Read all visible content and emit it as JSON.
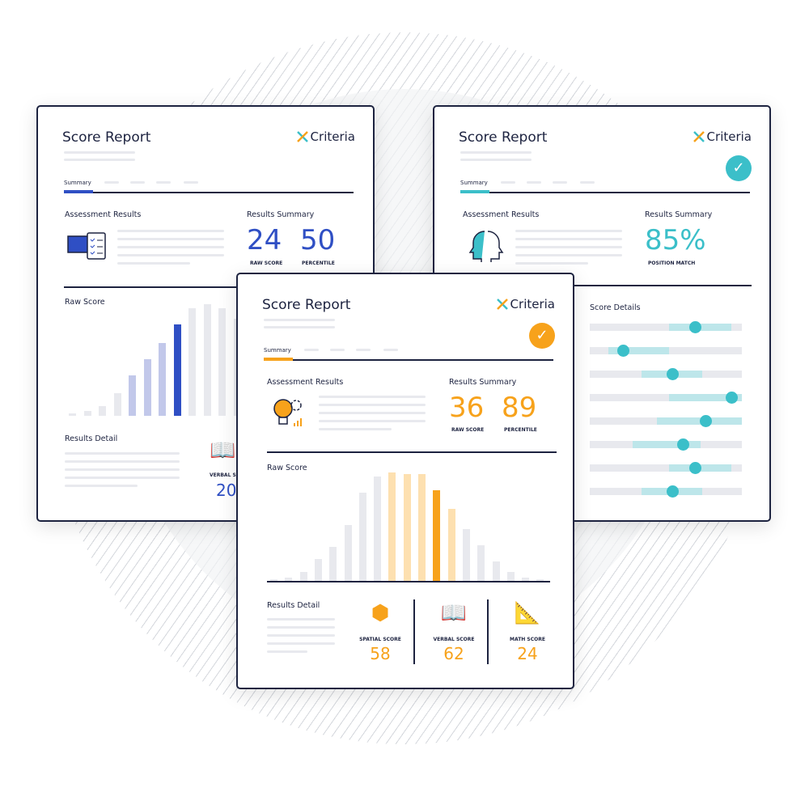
{
  "colors": {
    "navy": "#1d2340",
    "blue": "#2f4fc4",
    "teal": "#3bbfc9",
    "orange": "#f7a21b"
  },
  "brand": "Criteria",
  "left_card": {
    "title": "Score Report",
    "tab": "Summary",
    "assessment_heading": "Assessment Results",
    "summary_heading": "Results Summary",
    "raw_score": "24",
    "raw_score_label": "RAW SCORE",
    "percentile": "50",
    "percentile_label": "PERCENTILE",
    "chart_heading": "Raw Score",
    "detail_heading": "Results Detail",
    "verbal_label": "VERBAL SCORE",
    "verbal_value": "20",
    "icon": "computer-checklist-icon",
    "bars": [
      3,
      6,
      12,
      28,
      50,
      70,
      90,
      113,
      133,
      138,
      133,
      120
    ],
    "highlight_index": 7
  },
  "right_card": {
    "title": "Score Report",
    "tab": "Summary",
    "assessment_heading": "Assessment Results",
    "summary_heading": "Results Summary",
    "match": "85%",
    "match_label": "POSITION MATCH",
    "details_heading": "Score Details",
    "icon": "heads-profile-icon",
    "sliders": [
      {
        "range": [
          0.52,
          0.93
        ],
        "value": 0.69
      },
      {
        "range": [
          0.12,
          0.52
        ],
        "value": 0.22
      },
      {
        "range": [
          0.34,
          0.74
        ],
        "value": 0.54
      },
      {
        "range": [
          0.52,
          1.0
        ],
        "value": 0.93
      },
      {
        "range": [
          0.44,
          1.0
        ],
        "value": 0.76
      },
      {
        "range": [
          0.28,
          0.73
        ],
        "value": 0.61
      },
      {
        "range": [
          0.52,
          0.93
        ],
        "value": 0.69
      },
      {
        "range": [
          0.34,
          0.74
        ],
        "value": 0.54
      }
    ]
  },
  "front_card": {
    "title": "Score Report",
    "tab": "Summary",
    "assessment_heading": "Assessment Results",
    "summary_heading": "Results Summary",
    "raw_score": "36",
    "raw_score_label": "RAW SCORE",
    "percentile": "89",
    "percentile_label": "PERCENTILE",
    "chart_heading": "Raw Score",
    "detail_heading": "Results Detail",
    "icon": "lightbulb-gear-icon",
    "bars": [
      3,
      5,
      12,
      28,
      43,
      70,
      110,
      130,
      135,
      133,
      133,
      113,
      90,
      65,
      45,
      25,
      12,
      5,
      3
    ],
    "highlight_index": 11,
    "light_indices": [
      9,
      10,
      12
    ],
    "scores": [
      {
        "label": "SPATIAL SCORE",
        "value": "58",
        "icon": "blocks-gear-icon"
      },
      {
        "label": "VERBAL SCORE",
        "value": "62",
        "icon": "book-chat-icon"
      },
      {
        "label": "MATH SCORE",
        "value": "24",
        "icon": "math-board-icon"
      }
    ]
  }
}
